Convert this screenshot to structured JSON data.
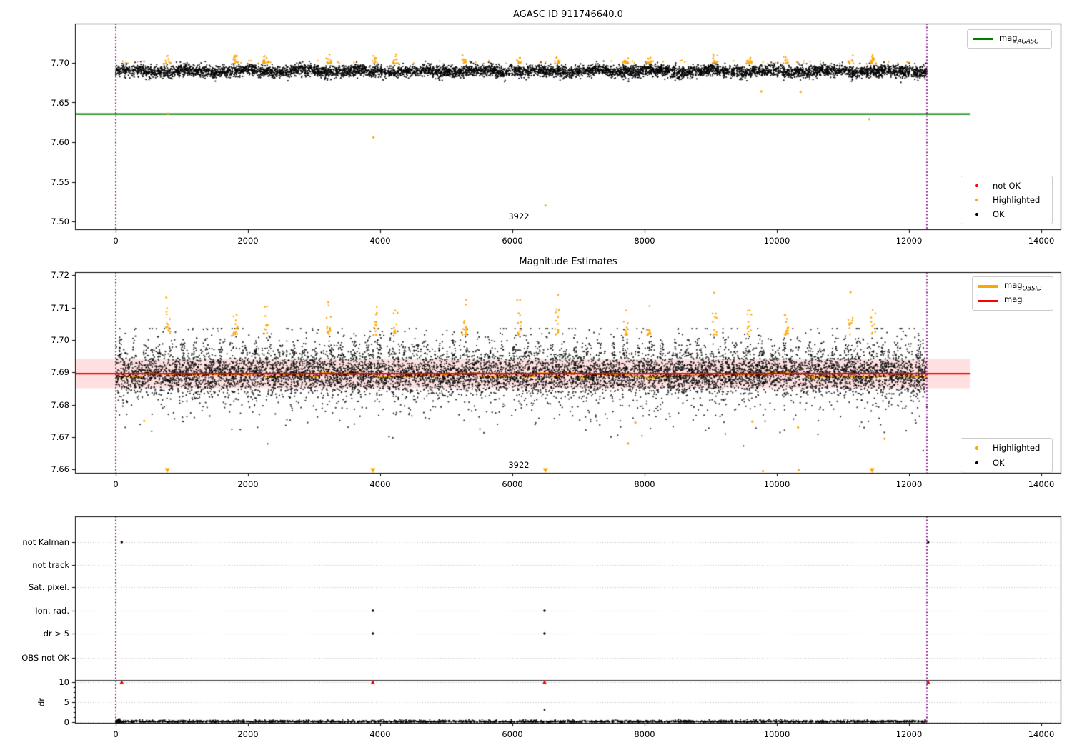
{
  "figure_title": "AGASC ID 911746640.0",
  "colors": {
    "ok": "#000000",
    "highlighted": "#FFA500",
    "not_ok": "#FF0000",
    "mag_agasc_line": "#008000",
    "mag_line": "#FF0000",
    "mag_obsid_line": "#FFA500",
    "obsid_boundary_line": "#800080",
    "band_fill": "#FF0000",
    "grid": "#b4b4b4"
  },
  "chart_data": [
    {
      "type": "scatter",
      "title": "AGASC ID 911746640.0",
      "xlabel": "",
      "ylabel": "",
      "xlim": [
        -620,
        14300
      ],
      "ylim": [
        7.489,
        7.7495
      ],
      "xticks": [
        0,
        2000,
        4000,
        6000,
        8000,
        10000,
        12000,
        14000
      ],
      "yticks": [
        7.5,
        7.55,
        7.6,
        7.65,
        7.7
      ],
      "obsid_boundaries_x": [
        0,
        12270
      ],
      "mag_agasc": 7.6355,
      "mag_agasc_line": {
        "y": 7.6355,
        "x_start": -620,
        "x_end": 12920
      },
      "ok_scatter": {
        "n": 6500,
        "x_min": 0,
        "x_max": 12270,
        "y_mean": 7.6895,
        "y_sigma": 0.0038,
        "y_min": 7.6745,
        "y_max": 7.7055
      },
      "highlighted_spikes_x": [
        790,
        1815,
        2270,
        3220,
        3925,
        4230,
        5275,
        6100,
        6680,
        7710,
        8065,
        9060,
        9580,
        10140,
        11115,
        11460
      ],
      "highlighted_spike_y_range": [
        7.699,
        7.7115
      ],
      "highlighted_outliers": [
        [
          790,
          7.636
        ],
        [
          3900,
          7.606
        ],
        [
          6500,
          7.52
        ],
        [
          9765,
          7.664
        ],
        [
          10360,
          7.6635
        ],
        [
          11400,
          7.629
        ]
      ],
      "annotation": {
        "text": "3922",
        "x": 6100,
        "y": 7.507
      },
      "legend_top": {
        "items": [
          {
            "label_main": "mag",
            "label_sub": "AGASC",
            "color": "#008000"
          }
        ]
      },
      "legend_bottom": {
        "items": [
          {
            "label": "not OK",
            "color": "#FF0000"
          },
          {
            "label": "Highlighted",
            "color": "#FFA500"
          },
          {
            "label": "OK",
            "color": "#000000"
          }
        ]
      }
    },
    {
      "type": "scatter",
      "title": "Magnitude Estimates",
      "xlabel": "",
      "ylabel": "",
      "xlim": [
        -620,
        14300
      ],
      "ylim": [
        7.6587,
        7.721
      ],
      "xticks": [
        0,
        2000,
        4000,
        6000,
        8000,
        10000,
        12000,
        14000
      ],
      "yticks": [
        7.66,
        7.67,
        7.68,
        7.69,
        7.7,
        7.71,
        7.72
      ],
      "obsid_boundaries_x": [
        0,
        12270
      ],
      "mag": 7.6896,
      "mag_line": {
        "y": 7.6896,
        "x_start": -620,
        "x_end": 12920
      },
      "mag_band": {
        "center": 7.6896,
        "half_width": 0.0045,
        "alpha": 0.12
      },
      "obsid_segments": {
        "x_start": 0,
        "x_end": 12270,
        "segment_length": 205,
        "y_center": 7.6893,
        "y_jitter": 0.0018
      },
      "ok_scatter": {
        "n": 9000,
        "x_min": 0,
        "x_max": 12270,
        "y_mean": 7.6895,
        "y_sigma_core": 0.003,
        "y_sigma_tail": 0.0075,
        "tail_fraction": 0.22,
        "y_min": 7.6615,
        "y_max": 7.7035
      },
      "highlighted_spikes_x": [
        790,
        1815,
        2270,
        3220,
        3925,
        4230,
        5275,
        6100,
        6680,
        7710,
        8065,
        9060,
        9580,
        10140,
        11115,
        11460
      ],
      "highlighted_spike_y_range": [
        7.7035,
        7.7148
      ],
      "highlighted_outliers": [
        [
          430,
          7.675
        ],
        [
          7750,
          7.668
        ],
        [
          7860,
          7.6745
        ],
        [
          9630,
          7.6748
        ],
        [
          10320,
          7.673
        ],
        [
          11630,
          7.6695
        ],
        [
          9790,
          7.6595
        ],
        [
          10330,
          7.6598
        ]
      ],
      "highlighted_triangles_x": [
        780,
        3890,
        6500,
        11440
      ],
      "annotation": {
        "text": "3922",
        "x": 6100,
        "y": 7.6613
      },
      "legend_top": {
        "items": [
          {
            "label_main": "mag",
            "label_sub": "OBSID",
            "color": "#FFA500"
          },
          {
            "label_main": "mag",
            "label_sub": "",
            "color": "#FF0000"
          }
        ]
      },
      "legend_bottom": {
        "items": [
          {
            "label": "Highlighted",
            "color": "#FFA500"
          },
          {
            "label": "OK",
            "color": "#000000"
          }
        ]
      }
    },
    {
      "type": "scatter",
      "title": "",
      "xlim": [
        -620,
        14300
      ],
      "xticks": [
        0,
        2000,
        4000,
        6000,
        8000,
        10000,
        12000,
        14000
      ],
      "categories": [
        "not Kalman",
        "not track",
        "Sat. pixel.",
        "Ion. rad.",
        "dr > 5",
        "OBS not OK"
      ],
      "dr_axis_label": "dr",
      "dr_ticks": [
        10,
        5,
        0
      ],
      "dr_threshold_line": 10.4,
      "obsid_boundaries_x": [
        0,
        12270
      ],
      "flags": {
        "not Kalman": [
          90,
          12290
        ],
        "not track": [],
        "Sat. pixel.": [],
        "Ion. rad.": [
          3890,
          6486
        ],
        "dr > 5": [
          3890,
          6486
        ],
        "OBS not OK": []
      },
      "not_ok_dr10_x": [
        90,
        3890,
        6486,
        12290
      ],
      "ok_dr_outlier": [
        6486,
        3.1
      ],
      "dr_scatter": {
        "n": 2600,
        "x_min": 0,
        "x_max": 12270,
        "dr_max": 0.7
      }
    }
  ]
}
